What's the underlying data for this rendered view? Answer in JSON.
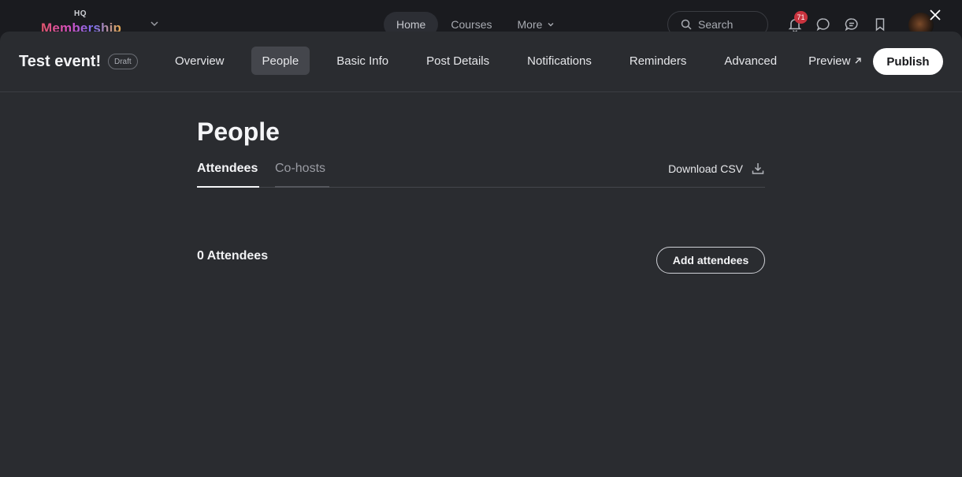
{
  "app": {
    "logo_small": "HQ",
    "logo_word": "Membership",
    "nav": [
      {
        "label": "Home",
        "active": true
      },
      {
        "label": "Courses",
        "active": false
      },
      {
        "label": "More",
        "active": false
      }
    ],
    "search_placeholder": "Search",
    "notification_count": "71"
  },
  "event": {
    "title": "Test event!",
    "status_badge": "Draft",
    "tabs": [
      {
        "label": "Overview",
        "active": false
      },
      {
        "label": "People",
        "active": true
      },
      {
        "label": "Basic Info",
        "active": false
      },
      {
        "label": "Post Details",
        "active": false
      },
      {
        "label": "Notifications",
        "active": false
      },
      {
        "label": "Reminders",
        "active": false
      },
      {
        "label": "Advanced",
        "active": false
      },
      {
        "label": "Preview",
        "active": false,
        "external": true
      }
    ],
    "publish_label": "Publish"
  },
  "people": {
    "heading": "People",
    "subtabs": [
      {
        "label": "Attendees",
        "active": true
      },
      {
        "label": "Co-hosts",
        "active": false
      }
    ],
    "download_label": "Download CSV",
    "count_label": "0 Attendees",
    "add_label": "Add attendees"
  },
  "icons": {
    "search": "search-icon",
    "bell": "bell-icon",
    "chat": "chat-icon",
    "messages": "messages-icon",
    "bookmark": "bookmark-icon",
    "close": "close-icon",
    "download": "download-icon",
    "external": "external-link-icon"
  }
}
